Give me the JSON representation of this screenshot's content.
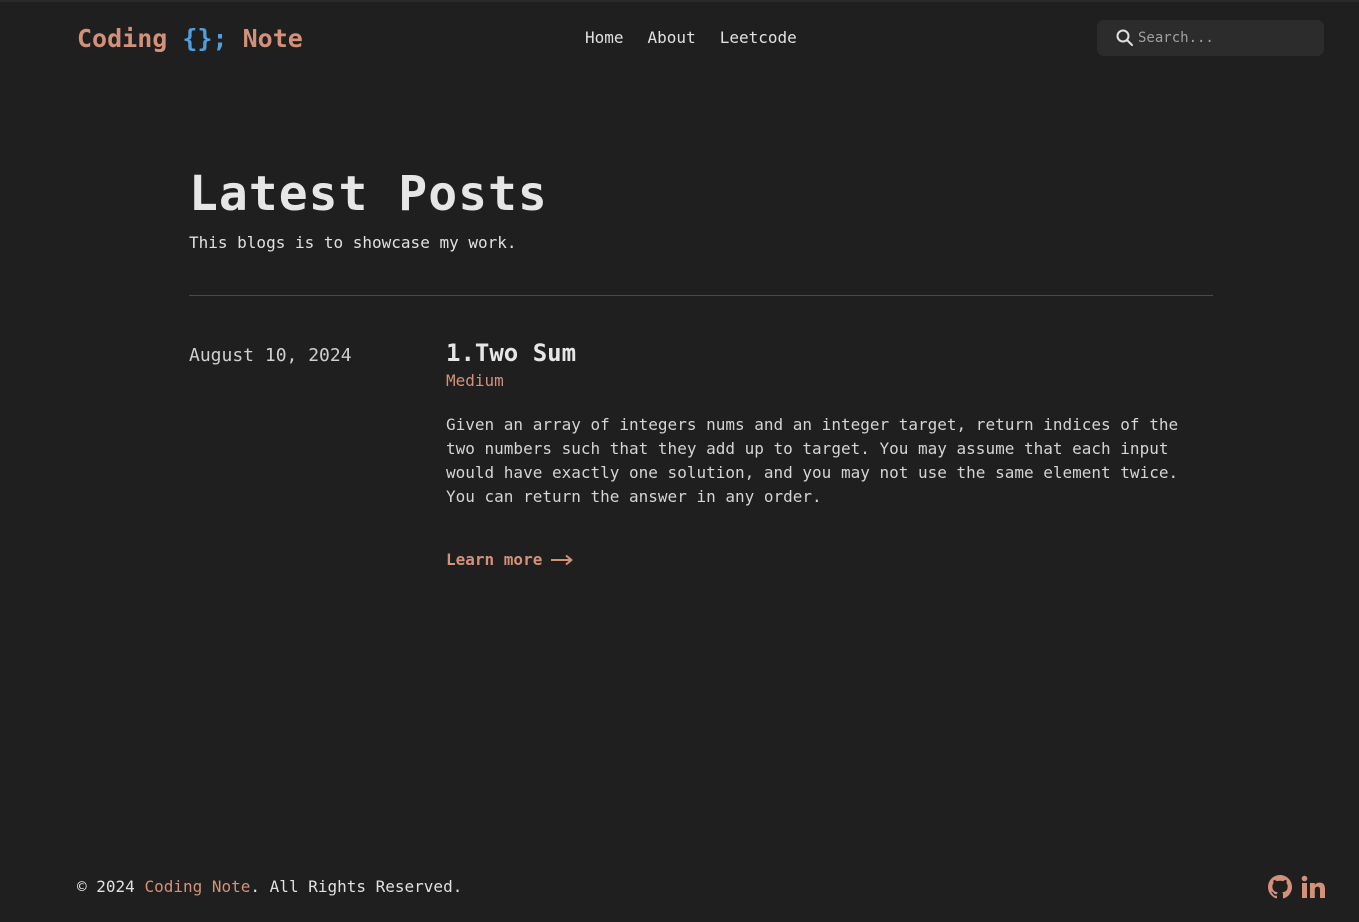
{
  "header": {
    "logo_prefix": "Coding",
    "logo_braces": "{};",
    "logo_suffix": "Note",
    "nav": [
      {
        "label": "Home"
      },
      {
        "label": "About"
      },
      {
        "label": "Leetcode"
      }
    ],
    "search": {
      "placeholder": "Search...",
      "icon": "search-icon"
    }
  },
  "main": {
    "title": "Latest Posts",
    "subtitle": "This blogs is to showcase my work.",
    "posts": [
      {
        "date": "August 10, 2024",
        "title": "1.Two Sum",
        "tag": "Medium",
        "summary": "Given an array of integers nums and an integer target, return indices of the two numbers such that they add up to target. You may assume that each input would have exactly one solution, and you may not use the same element twice. You can return the answer in any order.",
        "link_label": "Learn more",
        "link_icon": "arrow-right-icon"
      }
    ]
  },
  "footer": {
    "copyright_prefix": "© 2024",
    "brand": "Coding Note",
    "copyright_suffix": ". All Rights Reserved.",
    "social": [
      {
        "icon": "github-icon"
      },
      {
        "icon": "linkedin-icon"
      }
    ]
  },
  "colors": {
    "background": "#1f1f1f",
    "accent": "#d4917a",
    "brace": "#4f9ede",
    "text": "#d4d4d4"
  }
}
